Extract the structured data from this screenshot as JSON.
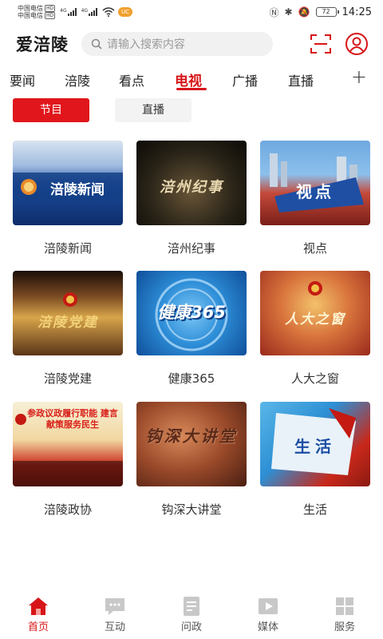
{
  "status_bar": {
    "carrier1": "中国电信",
    "carrier2": "中国电信",
    "hd": "HD",
    "net1": "4G",
    "net2": "4G",
    "notification": "UC",
    "battery": "72",
    "time": "14:25"
  },
  "header": {
    "app_title": "爱涪陵",
    "search_placeholder": "请输入搜索内容"
  },
  "tabs": [
    "要闻",
    "涪陵",
    "看点",
    "电视",
    "广播",
    "直播"
  ],
  "active_tab": "电视",
  "add_tab": "+",
  "subtabs": {
    "active": "节目",
    "inactive": "直播"
  },
  "programs": [
    {
      "label": "涪陵新闻",
      "thumb_text": "涪陵新闻"
    },
    {
      "label": "涪州纪事",
      "thumb_text": "涪州纪事"
    },
    {
      "label": "视点",
      "thumb_text": "视点"
    },
    {
      "label": "涪陵党建",
      "thumb_text": "涪陵党建"
    },
    {
      "label": "健康365",
      "thumb_text": "健康365"
    },
    {
      "label": "人大之窗",
      "thumb_text": "人大之窗"
    },
    {
      "label": "涪陵政协",
      "thumb_text": "参政议政履行职能 建言献策服务民生"
    },
    {
      "label": "钩深大讲堂",
      "thumb_text": "钩深大讲堂"
    },
    {
      "label": "生活",
      "thumb_text": "生活"
    }
  ],
  "bottom_nav": [
    {
      "label": "首页",
      "icon": "home-icon",
      "active": true
    },
    {
      "label": "互动",
      "icon": "chat-icon",
      "active": false
    },
    {
      "label": "问政",
      "icon": "document-icon",
      "active": false
    },
    {
      "label": "媒体",
      "icon": "media-icon",
      "active": false
    },
    {
      "label": "服务",
      "icon": "grid-icon",
      "active": false
    }
  ],
  "colors": {
    "accent": "#d71518",
    "inactive_icon": "#c8c8c8"
  }
}
